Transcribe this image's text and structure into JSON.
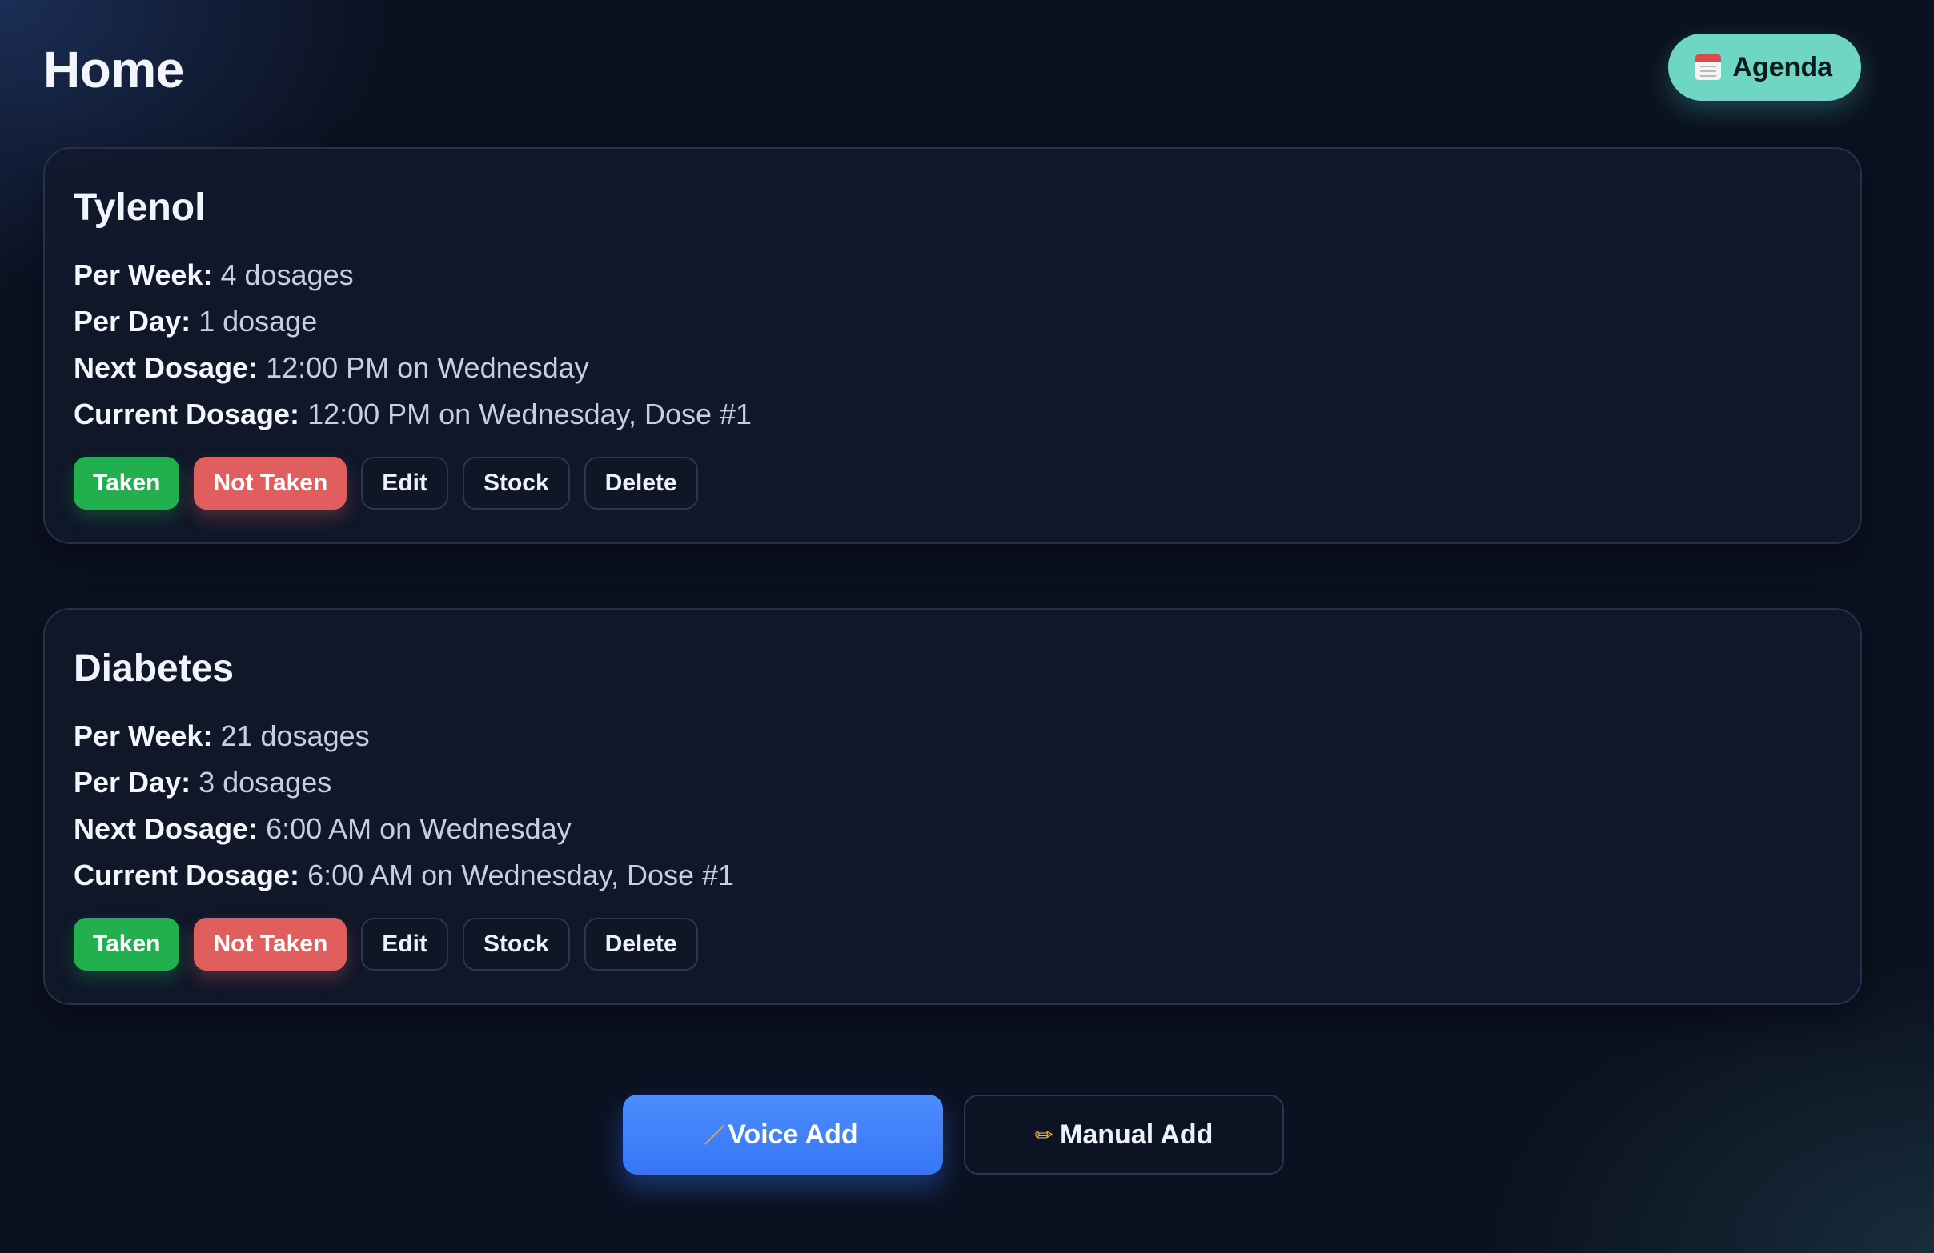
{
  "header": {
    "title": "Home",
    "agenda_label": "Agenda",
    "agenda_icon": "calendar-icon"
  },
  "medications": [
    {
      "name": "Tylenol",
      "per_week_label": "Per Week:",
      "per_week_value": "4 dosages",
      "per_day_label": "Per Day:",
      "per_day_value": "1 dosage",
      "next_label": "Next Dosage:",
      "next_value": "12:00 PM on Wednesday",
      "current_label": "Current Dosage:",
      "current_value": "12:00 PM on Wednesday, Dose #1",
      "actions": {
        "taken": "Taken",
        "not_taken": "Not Taken",
        "edit": "Edit",
        "stock": "Stock",
        "delete": "Delete"
      }
    },
    {
      "name": "Diabetes",
      "per_week_label": "Per Week:",
      "per_week_value": "21 dosages",
      "per_day_label": "Per Day:",
      "per_day_value": "3 dosages",
      "next_label": "Next Dosage:",
      "next_value": "6:00 AM on Wednesday",
      "current_label": "Current Dosage:",
      "current_value": "6:00 AM on Wednesday, Dose #1",
      "actions": {
        "taken": "Taken",
        "not_taken": "Not Taken",
        "edit": "Edit",
        "stock": "Stock",
        "delete": "Delete"
      }
    }
  ],
  "footer": {
    "voice_add_label": "Voice Add",
    "voice_add_icon": "microphone-icon",
    "manual_add_label": "Manual Add",
    "manual_add_icon": "pencil-icon"
  },
  "colors": {
    "background": "#0b1120",
    "agenda_button": "#6fd6c6",
    "taken": "#22b04f",
    "not_taken": "#e15e5e",
    "voice_add": "#4d8dff"
  }
}
